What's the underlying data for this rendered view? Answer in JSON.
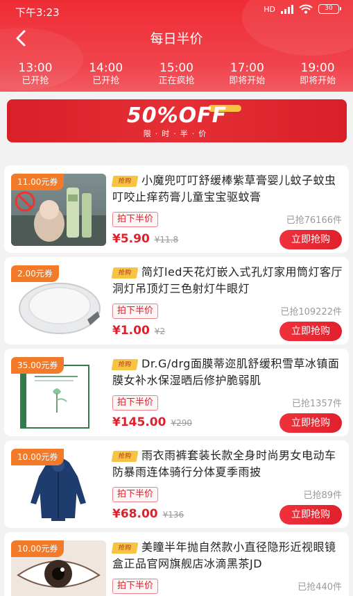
{
  "status_bar": {
    "time": "下午3:23",
    "net": "HD",
    "battery": "30"
  },
  "nav": {
    "title": "每日半价"
  },
  "time_tabs": [
    {
      "time": "13:00",
      "status": "已开抢"
    },
    {
      "time": "14:00",
      "status": "已开抢"
    },
    {
      "time": "15:00",
      "status": "正在疯抢"
    },
    {
      "time": "17:00",
      "status": "即将开始"
    },
    {
      "time": "19:00",
      "status": "即将开始"
    }
  ],
  "banner": {
    "headline": "50%OFF",
    "sub": "限·时·半·价"
  },
  "products": [
    {
      "coupon": "11.00元券",
      "badge": "抢购",
      "title": "小魔兜叮叮舒缓棒紫草膏婴儿蚊子蚊虫叮咬止痒药膏儿童宝宝驱蚊膏",
      "tag": "拍下半价",
      "sold": "已抢76166件",
      "price": "¥5.90",
      "original": "¥11.8",
      "button": "立即抢购",
      "image": "baby-cream-tube"
    },
    {
      "coupon": "2.00元券",
      "badge": "抢购",
      "title": "简灯led天花灯嵌入式孔灯家用筒灯客厅洞灯吊顶灯三色射灯牛眼灯",
      "tag": "拍下半价",
      "sold": "已抢109222件",
      "price": "¥1.00",
      "original": "¥2",
      "button": "立即抢购",
      "image": "led-downlight"
    },
    {
      "coupon": "35.00元券",
      "badge": "抢购",
      "title": "Dr.G/drg面膜蒂迩肌舒缓积雪草冰镇面膜女补水保湿晒后修护脆弱肌",
      "tag": "拍下半价",
      "sold": "已抢1357件",
      "price": "¥145.00",
      "original": "¥290",
      "button": "立即抢购",
      "image": "face-mask-box"
    },
    {
      "coupon": "10.00元券",
      "badge": "抢购",
      "title": "雨衣雨裤套装长款全身时尚男女电动车防暴雨连体骑行分体夏季雨披",
      "tag": "拍下半价",
      "sold": "已抢89件",
      "price": "¥68.00",
      "original": "¥136",
      "button": "立即抢购",
      "image": "raincoat"
    },
    {
      "coupon": "10.00元券",
      "badge": "抢购",
      "title": "美瞳半年抛自然款小直径隐形近视眼镜盒正品官网旗舰店冰滴黑茶JD",
      "tag": "拍下半价",
      "sold": "已抢440件",
      "price": "",
      "original": "",
      "button": "",
      "image": "contact-lens-eye"
    }
  ],
  "colors": {
    "primary_red": "#e0202b",
    "header_red": "#ef2c34",
    "coupon_orange": "#f27a28",
    "badge_yellow": "#f6c343"
  }
}
